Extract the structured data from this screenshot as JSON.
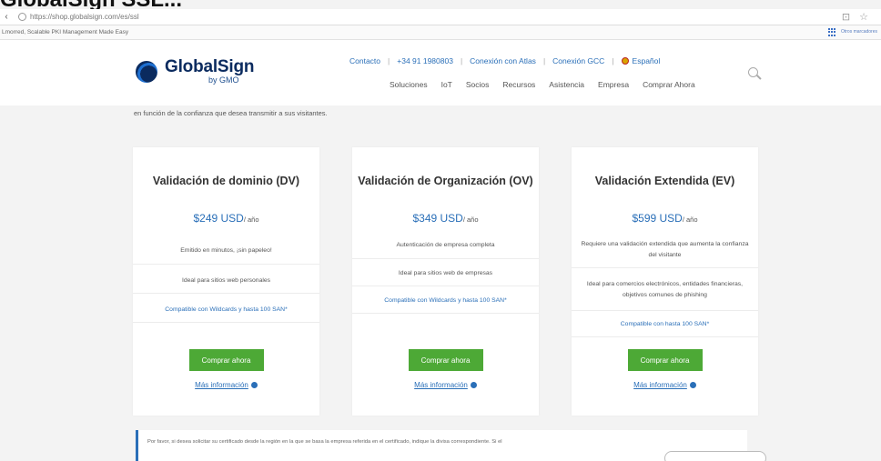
{
  "crop_heading": "GlobalSign SSL...",
  "browser": {
    "url": "https://shop.globalsign.com/es/ssl",
    "nav_back": "‹",
    "icons": [
      "bookmark-icon",
      "star-icon"
    ]
  },
  "bookmarks": {
    "first": "Lmorred, Scalable PKI Management Made Easy",
    "apps_label": "Apps",
    "note": "Otros marcadores"
  },
  "header": {
    "logo_name": "GlobalSign",
    "logo_sub": "by GMO",
    "utility": [
      "Contacto",
      "+34 91 1980803",
      "Conexión con Atlas",
      "Conexión GCC",
      "Español"
    ],
    "nav": [
      "Soluciones",
      "IoT",
      "Socios",
      "Recursos",
      "Asistencia",
      "Empresa",
      "Comprar Ahora"
    ]
  },
  "intro": "en función de la confianza que desea transmitir a sus visitantes.",
  "cards": [
    {
      "title": "Validación de dominio (DV)",
      "price": "$249 USD",
      "unit": "/ año",
      "features": [
        "Emitido en minutos, ¡sin papeleo!",
        "Ideal para sitios web personales",
        "Compatible con Wildcards y hasta 100 SAN*"
      ],
      "buy": "Comprar ahora",
      "more": "Más información"
    },
    {
      "title": "Validación de Organización (OV)",
      "price": "$349 USD",
      "unit": "/ año",
      "features": [
        "Autenticación de empresa completa",
        "Ideal para sitios web de empresas",
        "Compatible con Wildcards y hasta 100 SAN*"
      ],
      "buy": "Comprar ahora",
      "more": "Más información"
    },
    {
      "title": "Validación Extendida (EV)",
      "price": "$599 USD",
      "unit": "/ año",
      "features": [
        "Requiere una validación extendida que aumenta la confianza del visitante",
        "Ideal para comercios electrónicos, entidades financieras, objetivos comunes de phishing",
        "Compatible con hasta 100 SAN*"
      ],
      "buy": "Comprar ahora",
      "more": "Más información"
    }
  ],
  "notice": "Por favor, si desea solicitar su certificado desde la región en la que se basa la empresa referida en el certificado, indique la divisa correspondiente. Si el"
}
